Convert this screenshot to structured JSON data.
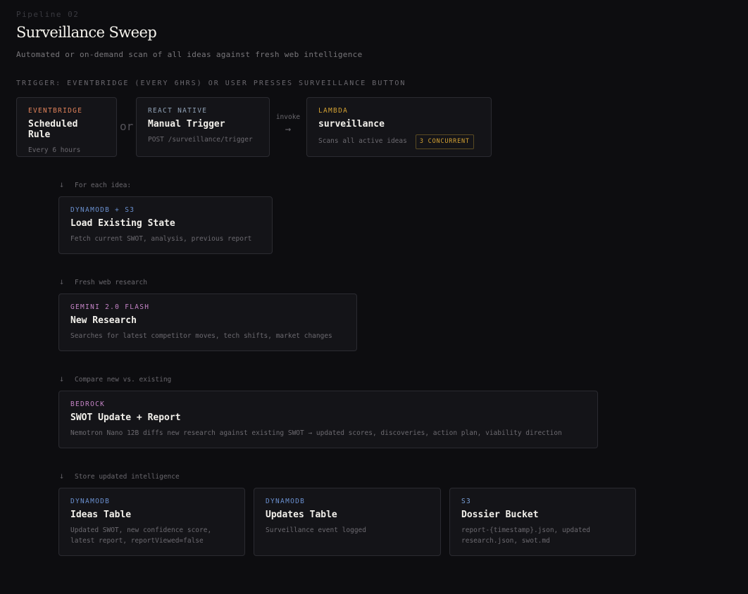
{
  "header": {
    "eyebrow": "Pipeline 02",
    "title": "Surveillance Sweep",
    "subtitle": "Automated or on-demand scan of all ideas against fresh web intelligence"
  },
  "trigger_label": "TRIGGER: EVENTBRIDGE (EVERY 6HRS) OR USER PRESSES SURVEILLANCE BUTTON",
  "trigger": {
    "or_label": "or",
    "invoke_label": "invoke",
    "invoke_arrow": "→",
    "eventbridge": {
      "kind": "EVENTBRIDGE",
      "title": "Scheduled Rule",
      "desc": "Every 6 hours"
    },
    "react_native": {
      "kind": "REACT NATIVE",
      "title": "Manual Trigger",
      "desc": "POST /surveillance/trigger"
    },
    "lambda": {
      "kind": "LAMBDA",
      "title": "surveillance",
      "desc": "Scans all active ideas",
      "badge": "3 CONCURRENT"
    }
  },
  "steps": [
    {
      "arrow": "↓",
      "label": "For each idea:"
    },
    {
      "arrow": "↓",
      "label": "Fresh web research"
    },
    {
      "arrow": "↓",
      "label": "Compare new vs. existing"
    },
    {
      "arrow": "↓",
      "label": "Store updated intelligence"
    }
  ],
  "load_state": {
    "kind": "DYNAMODB + S3",
    "title": "Load Existing State",
    "desc": "Fetch current SWOT, analysis, previous report"
  },
  "research": {
    "kind": "GEMINI 2.0 FLASH",
    "title": "New Research",
    "desc": "Searches for latest competitor moves, tech shifts, market changes"
  },
  "swot": {
    "kind": "BEDROCK",
    "title": "SWOT Update + Report",
    "desc": "Nemotron Nano 12B diffs new research against existing SWOT → updated scores, discoveries, action plan, viability direction"
  },
  "stores": [
    {
      "kind": "DYNAMODB",
      "title": "Ideas Table",
      "desc": "Updated SWOT, new confidence score, latest report, reportViewed=false"
    },
    {
      "kind": "DYNAMODB",
      "title": "Updates Table",
      "desc": "Surveillance event logged"
    },
    {
      "kind": "S3",
      "title": "Dossier Bucket",
      "desc": "report-{timestamp}.json, updated research.json, swot.md"
    }
  ],
  "colors": {
    "background": "#0d0d10",
    "card": "#141418",
    "eventbridge": "#e0825a",
    "react_native": "#8fa0b4",
    "lambda": "#d4a233",
    "dynamodb": "#6a90d0",
    "gemini": "#c483c6",
    "bedrock": "#c483c6",
    "s3": "#7aa0d8"
  }
}
